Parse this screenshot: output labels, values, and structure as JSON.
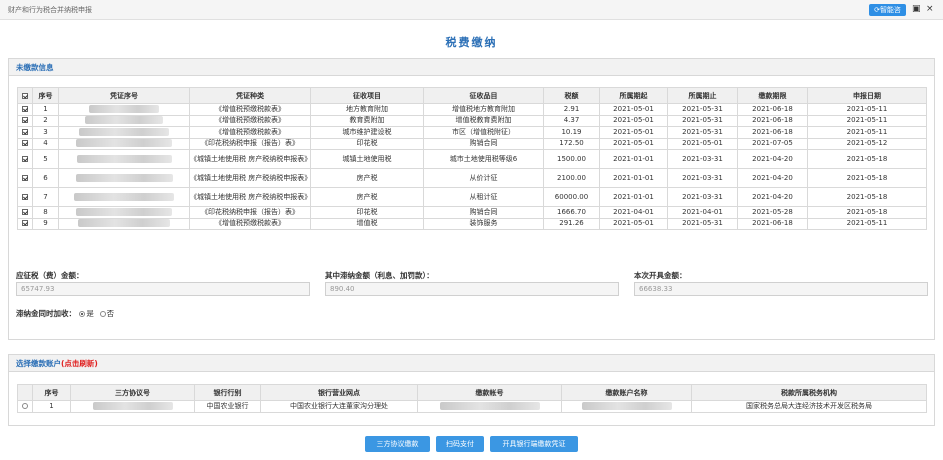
{
  "header": {
    "breadcrumb": "财产和行为税合并纳税申报",
    "assistant_label": "智能咨",
    "icon_a": "▣",
    "close": "×"
  },
  "page_title": "税费缴纳",
  "unpaid": {
    "section_title": "未缴款信息",
    "columns": [
      "序号",
      "凭证序号",
      "凭证种类",
      "征收项目",
      "征收品目",
      "税额",
      "所属期起",
      "所属期止",
      "缴款期限",
      "申报日期"
    ],
    "rows": [
      {
        "seq": "1",
        "type": "《增值税预缴税款表》",
        "item": "地方教育附加",
        "sub": "增值税地方教育附加",
        "tax": "2.91",
        "from": "2021-05-01",
        "to": "2021-05-31",
        "deadline": "2021-06-18",
        "date": "2021-05-11"
      },
      {
        "seq": "2",
        "type": "《增值税预缴税款表》",
        "item": "教育费附加",
        "sub": "增值税教育费附加",
        "tax": "4.37",
        "from": "2021-05-01",
        "to": "2021-05-31",
        "deadline": "2021-06-18",
        "date": "2021-05-11"
      },
      {
        "seq": "3",
        "type": "《增值税预缴税款表》",
        "item": "城市维护建设税",
        "sub": "市区（增值税附征）",
        "tax": "10.19",
        "from": "2021-05-01",
        "to": "2021-05-31",
        "deadline": "2021-06-18",
        "date": "2021-05-11"
      },
      {
        "seq": "4",
        "type": "《印花税纳税申报（报告）表》",
        "item": "印花税",
        "sub": "购销合同",
        "tax": "172.50",
        "from": "2021-05-01",
        "to": "2021-05-01",
        "deadline": "2021-07-05",
        "date": "2021-05-12"
      },
      {
        "seq": "5",
        "type": "《城镇土地使用税 房产税纳税申报表》",
        "item": "城镇土地使用税",
        "sub": "城市土地使用税等级6",
        "tax": "1500.00",
        "from": "2021-01-01",
        "to": "2021-03-31",
        "deadline": "2021-04-20",
        "date": "2021-05-18"
      },
      {
        "seq": "6",
        "type": "《城镇土地使用税 房产税纳税申报表》",
        "item": "房产税",
        "sub": "从价计征",
        "tax": "2100.00",
        "from": "2021-01-01",
        "to": "2021-03-31",
        "deadline": "2021-04-20",
        "date": "2021-05-18"
      },
      {
        "seq": "7",
        "type": "《城镇土地使用税 房产税纳税申报表》",
        "item": "房产税",
        "sub": "从租计征",
        "tax": "60000.00",
        "from": "2021-01-01",
        "to": "2021-03-31",
        "deadline": "2021-04-20",
        "date": "2021-05-18"
      },
      {
        "seq": "8",
        "type": "《印花税纳税申报（报告）表》",
        "item": "印花税",
        "sub": "购销合同",
        "tax": "1666.70",
        "from": "2021-04-01",
        "to": "2021-04-01",
        "deadline": "2021-05-28",
        "date": "2021-05-18"
      },
      {
        "seq": "9",
        "type": "《增值税预缴税款表》",
        "item": "增值税",
        "sub": "装饰服务",
        "tax": "291.26",
        "from": "2021-05-01",
        "to": "2021-05-31",
        "deadline": "2021-06-18",
        "date": "2021-05-11"
      }
    ]
  },
  "totals": {
    "payable_label": "应征税（费）金额：",
    "payable_value": "65747.93",
    "overdue_label": "其中滞纳金额（利息、加罚款）：",
    "overdue_value": "890.40",
    "invoice_label": "本次开具金额：",
    "invoice_value": "66638.33",
    "late_fee_label": "滞纳金同时加收：",
    "yes": "是",
    "no": "否",
    "late_fee_selected": "yes"
  },
  "account": {
    "section_title": "选择缴款账户",
    "refresh_hint": "(点击刷新)",
    "columns": [
      "序号",
      "三方协议号",
      "银行行别",
      "银行营业网点",
      "缴款帐号",
      "缴款账户名称",
      "税款所属税务机构"
    ],
    "rows": [
      {
        "seq": "1",
        "bank": "中国农业银行",
        "branch": "中国农业银行大连董家沟分理处",
        "office": "国家税务总局大连经济技术开发区税务局"
      }
    ]
  },
  "buttons": {
    "tripartite": "三方协议缴款",
    "scan": "扫码支付",
    "bank_voucher": "开具银行端缴款凭证"
  }
}
